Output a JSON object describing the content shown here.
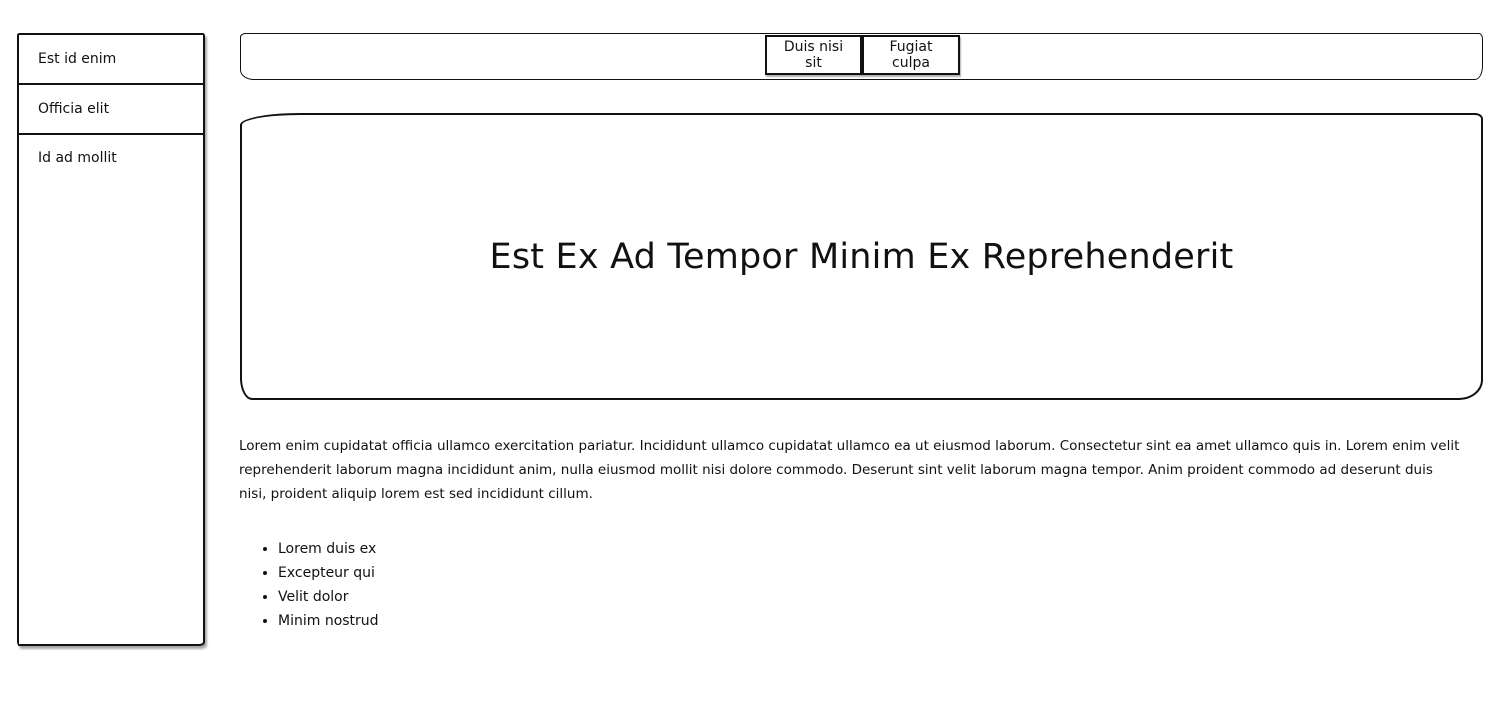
{
  "sidebar": {
    "items": [
      {
        "label": "Est id enim"
      },
      {
        "label": "Officia elit"
      },
      {
        "label": "Id ad mollit"
      }
    ]
  },
  "navbar": {
    "buttons": [
      {
        "label": "Duis nisi sit"
      },
      {
        "label": "Fugiat culpa"
      }
    ]
  },
  "hero": {
    "title": "Est Ex Ad Tempor Minim Ex Reprehenderit"
  },
  "content": {
    "paragraph": "Lorem enim cupidatat officia ullamco exercitation pariatur. Incididunt ullamco cupidatat ullamco ea ut eiusmod laborum. Consectetur sint ea amet ullamco quis in. Lorem enim velit reprehenderit laborum magna incididunt anim, nulla eiusmod mollit nisi dolore commodo. Deserunt sint velit laborum magna tempor. Anim proident commodo ad deserunt duis nisi, proident aliquip lorem est sed incididunt cillum.",
    "list": [
      "Lorem duis ex",
      "Excepteur qui",
      "Velit dolor",
      "Minim nostrud"
    ]
  },
  "colors": {
    "border": "#111111",
    "background": "#ffffff",
    "text": "#111111"
  }
}
